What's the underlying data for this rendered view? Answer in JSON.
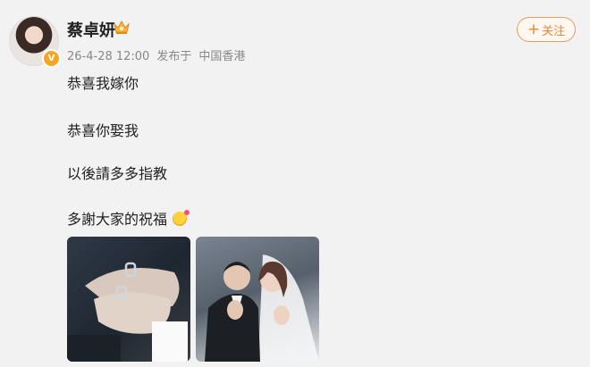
{
  "user": {
    "name": "蔡卓妍",
    "verified_badge": "V",
    "crown_icon": "crown-icon"
  },
  "meta": {
    "timestamp": "26-4-28 12:00",
    "source": "发布于",
    "location": "中国香港"
  },
  "follow_button": {
    "plus": "+",
    "label": "关注"
  },
  "post": {
    "lines": [
      "恭喜我嫁你",
      "恭喜你娶我",
      "以後請多多指教",
      "多謝大家的祝福"
    ],
    "emoji_icon": "smiling-face-with-hearts-icon"
  },
  "colors": {
    "accent": "#e8863c",
    "text": "#222222",
    "meta": "#888888",
    "background": "#f2f2f2"
  }
}
